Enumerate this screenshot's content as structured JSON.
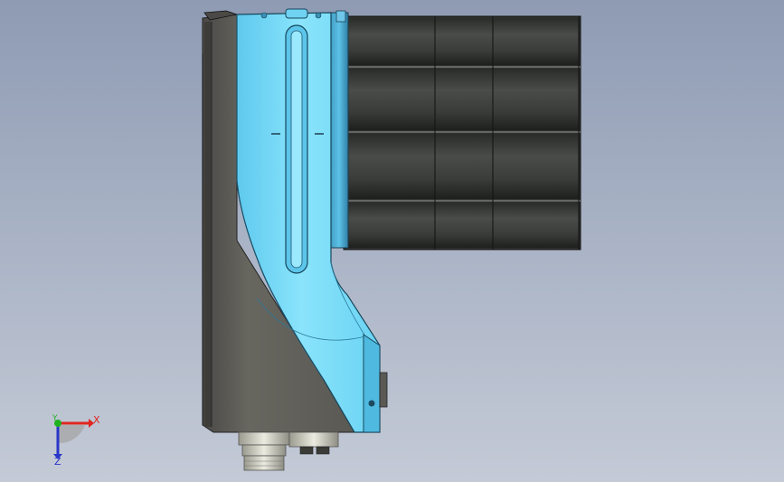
{
  "viewport": {
    "background_top": "#8e9bb3",
    "background_bottom": "#c4cad6"
  },
  "model": {
    "bracket_color": "#6fd2f2",
    "motor_color": "#3a3c3a",
    "side_plate_color": "#5f5e5a"
  },
  "triad": {
    "x_label": "X",
    "y_label": "Y",
    "z_label": "Z",
    "x_color": "#e0261f",
    "y_color": "#1fb21f",
    "z_color": "#2a35c9"
  }
}
